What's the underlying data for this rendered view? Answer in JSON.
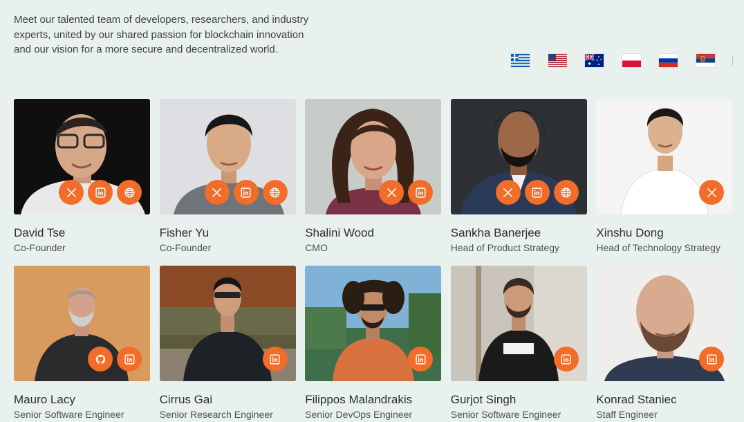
{
  "intro_text": "Meet our talented team of developers, researchers, and industry experts, united by our shared passion for blockchain innovation and our vision for a more secure and decentralized world.",
  "languages": [
    {
      "code": "greece-flag"
    },
    {
      "code": "usa-flag"
    },
    {
      "code": "australia-flag"
    },
    {
      "code": "poland-flag"
    },
    {
      "code": "russia-flag"
    },
    {
      "code": "serbia-flag"
    }
  ],
  "colors": {
    "accent": "#f26c2a",
    "background": "#e9f1ee"
  },
  "team": [
    {
      "name": "David Tse",
      "role": "Co-Founder",
      "icons": [
        "x-icon",
        "linkedin-icon",
        "globe-icon"
      ]
    },
    {
      "name": "Fisher Yu",
      "role": "Co-Founder",
      "icons": [
        "x-icon",
        "linkedin-icon",
        "globe-icon"
      ]
    },
    {
      "name": "Shalini Wood",
      "role": "CMO",
      "icons": [
        "x-icon",
        "linkedin-icon"
      ]
    },
    {
      "name": "Sankha Banerjee",
      "role": "Head of Product Strategy",
      "icons": [
        "x-icon",
        "linkedin-icon",
        "globe-icon"
      ]
    },
    {
      "name": "Xinshu Dong",
      "role": "Head of Technology Strategy",
      "icons": [
        "x-icon"
      ]
    },
    {
      "name": "Mauro Lacy",
      "role": "Senior Software Engineer",
      "icons": [
        "github-icon",
        "linkedin-icon"
      ]
    },
    {
      "name": "Cirrus Gai",
      "role": "Senior Research Engineer",
      "icons": [
        "linkedin-icon"
      ]
    },
    {
      "name": "Filippos Malandrakis",
      "role": "Senior DevOps Engineer",
      "icons": [
        "linkedin-icon"
      ]
    },
    {
      "name": "Gurjot Singh",
      "role": "Senior Software Engineer",
      "icons": [
        "linkedin-icon"
      ]
    },
    {
      "name": "Konrad Staniec",
      "role": "Staff Engineer",
      "icons": [
        "linkedin-icon"
      ]
    }
  ]
}
